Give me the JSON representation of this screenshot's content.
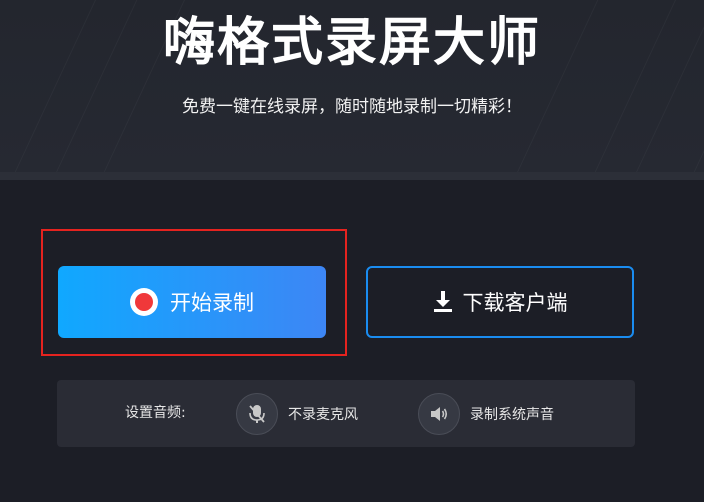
{
  "hero": {
    "title": "嗨格式录屏大师",
    "subtitle": "免费一键在线录屏，随时随地录制一切精彩！"
  },
  "actions": {
    "start_label": "开始录制",
    "download_label": "下载客户端"
  },
  "audio": {
    "label": "设置音频:",
    "options": [
      {
        "label": "不录麦克风",
        "icon": "microphone-off-icon"
      },
      {
        "label": "录制系统声音",
        "icon": "speaker-icon"
      }
    ]
  },
  "colors": {
    "accent": "#1a8cf0",
    "record_dot": "#f0383a",
    "highlight": "#e5231f"
  }
}
